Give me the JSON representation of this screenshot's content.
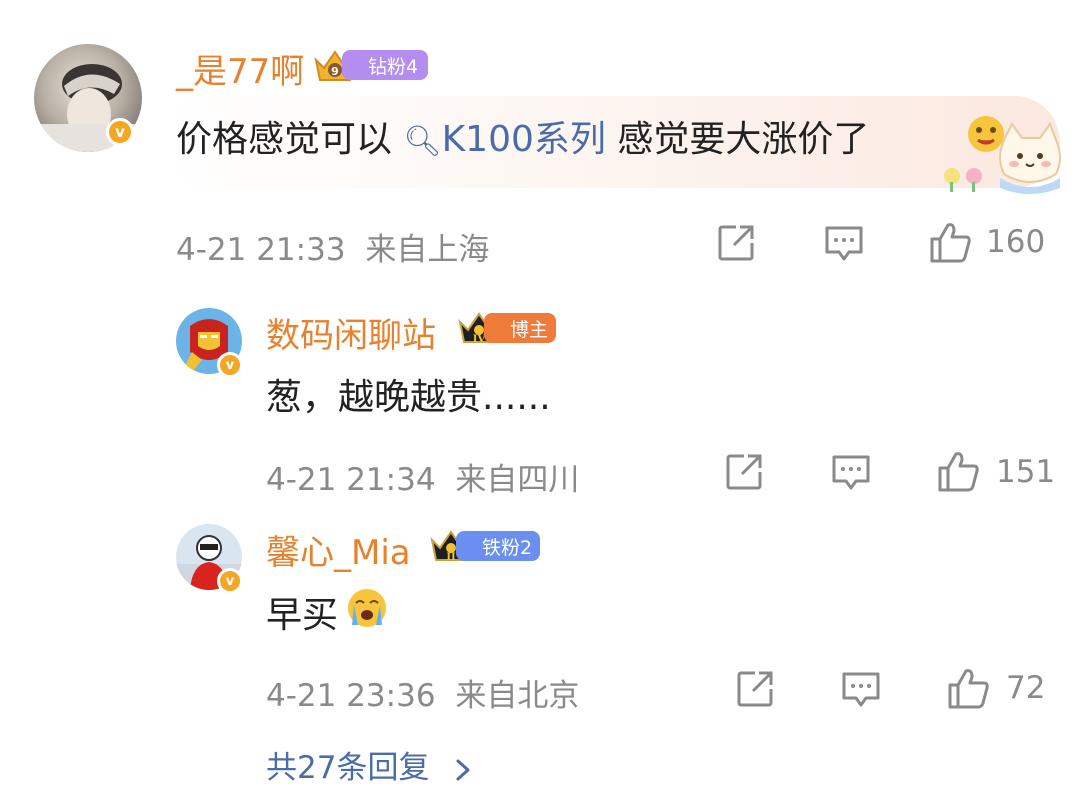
{
  "comment": {
    "username": "_是77啊",
    "level_label": "钻粉4",
    "level_color": "#b48df0",
    "text_before": "价格感觉可以",
    "topic": "K100系列",
    "text_after": "感觉要大涨价了",
    "time": "4-21 21:33",
    "location": "来自上海",
    "likes": "160"
  },
  "replies": [
    {
      "username": "数码闲聊站",
      "badge_label": "博主",
      "badge_color": "#f07a3a",
      "text": "葱，越晚越贵......",
      "time": "4-21 21:34",
      "location": "来自四川",
      "likes": "151"
    },
    {
      "username": "馨心_Mia",
      "badge_label": "铁粉2",
      "badge_color": "#6a8ff0",
      "text": "早买",
      "time": "4-21 23:36",
      "location": "来自北京",
      "likes": "72"
    }
  ],
  "more_replies": "共27条回复",
  "icons": {
    "share": "share-icon",
    "comment": "comment-icon",
    "like": "thumbs-up-icon",
    "verified": "verified-v-icon",
    "chevron": "chevron-right-icon"
  },
  "colors": {
    "username": "#e8812d",
    "topic": "#4a6ca8",
    "meta": "#8a8a8a",
    "verified": "#f5a623"
  }
}
